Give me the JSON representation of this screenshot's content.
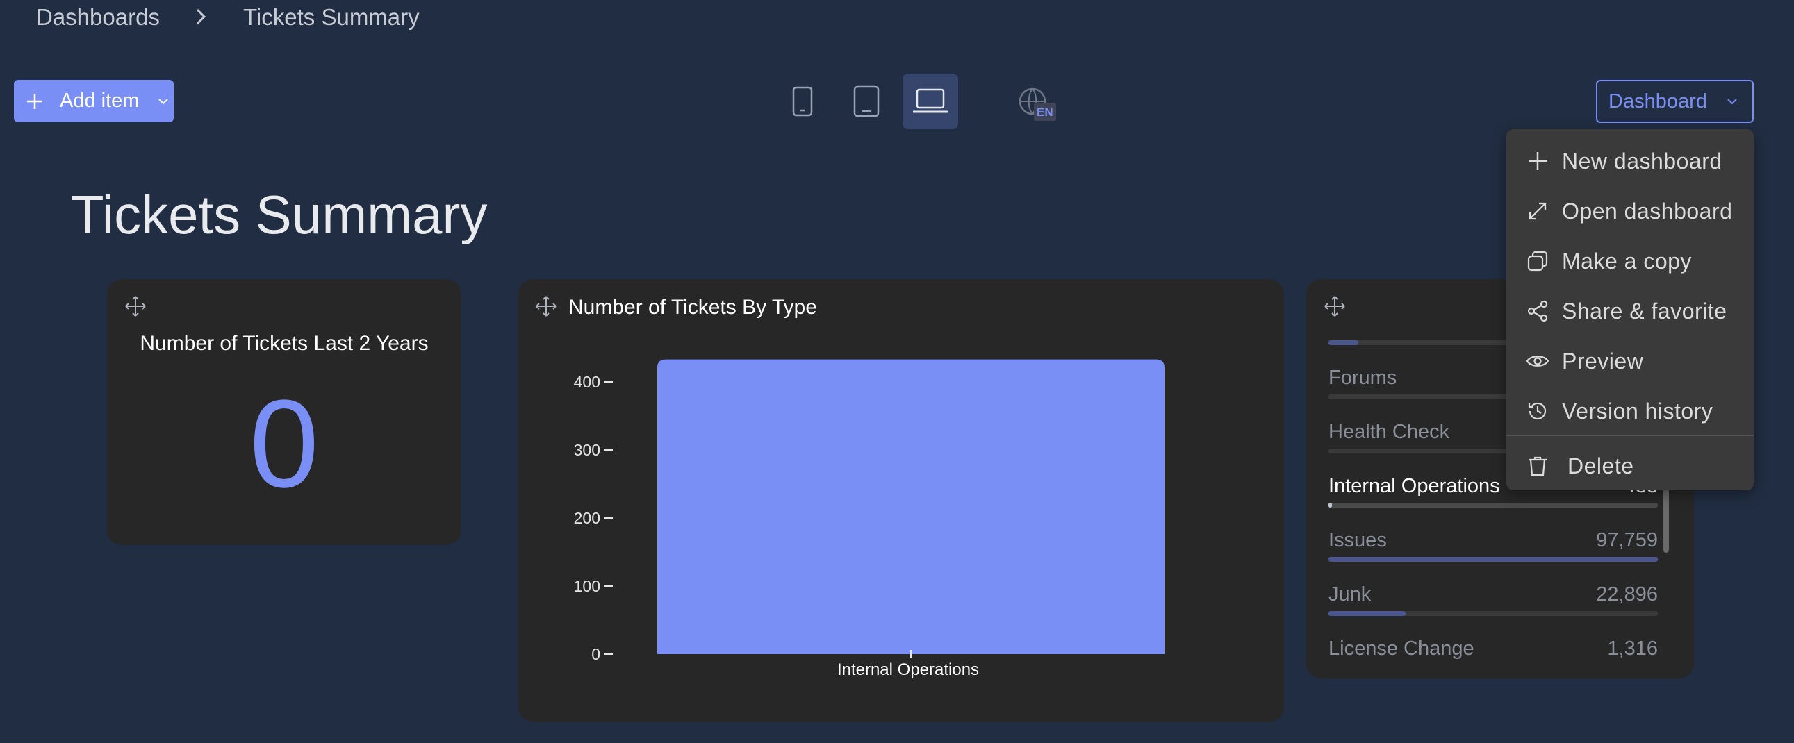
{
  "breadcrumb": {
    "root": "Dashboards",
    "current": "Tickets Summary"
  },
  "toolbar": {
    "add_item": "Add item",
    "dashboard_menu": "Dashboard",
    "locale_badge": "EN"
  },
  "page_title": "Tickets Summary",
  "cards": {
    "kpi": {
      "title": "Number of Tickets Last 2 Years",
      "value": "0"
    },
    "bar": {
      "title": "Number of Tickets By Type"
    },
    "list": {
      "rows": [
        {
          "label": "Forums",
          "value": "",
          "fill": 0
        },
        {
          "label": "Health Check",
          "value": "",
          "fill": 0
        },
        {
          "label": "Internal Operations",
          "value": "433",
          "fill": 0.004
        },
        {
          "label": "Issues",
          "value": "97,759",
          "fill": 1.0
        },
        {
          "label": "Junk",
          "value": "22,896",
          "fill": 0.234
        },
        {
          "label": "License Change",
          "value": "1,316",
          "fill": 0.013
        }
      ]
    }
  },
  "menu": {
    "items": [
      {
        "label": "New dashboard",
        "icon": "plus-icon"
      },
      {
        "label": "Open dashboard",
        "icon": "expand-icon"
      },
      {
        "label": "Make a copy",
        "icon": "copy-icon"
      },
      {
        "label": "Share & favorite",
        "icon": "share-icon"
      },
      {
        "label": "Preview",
        "icon": "eye-icon"
      },
      {
        "label": "Version history",
        "icon": "history-icon"
      },
      {
        "label": "Delete",
        "icon": "trash-icon"
      }
    ]
  },
  "colors": {
    "accent": "#7a8ff5",
    "background": "#212d42",
    "card": "#272727"
  },
  "chart_data": {
    "type": "bar",
    "title": "Number of Tickets By Type",
    "categories": [
      "Internal Operations"
    ],
    "values": [
      433
    ],
    "ylim": [
      0,
      433
    ],
    "yticks": [
      "400",
      "300",
      "200",
      "100",
      "0"
    ],
    "xlabel": "",
    "ylabel": ""
  }
}
